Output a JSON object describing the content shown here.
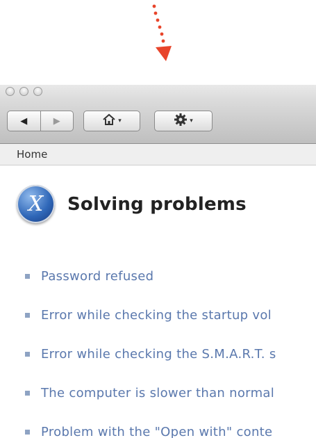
{
  "window": {
    "toolbar": {
      "back_label": "◀",
      "forward_label": "▶",
      "home_icon": "home-icon",
      "settings_icon": "gear-icon",
      "caret": "▾"
    },
    "breadcrumb": "Home"
  },
  "main": {
    "title": "Solving problems",
    "logo_letter": "X",
    "problems": [
      "Password refused",
      "Error while checking the startup vol",
      "Error while checking the S.M.A.R.T. s",
      "The computer is slower than normal",
      "Problem with the \"Open with\" conte"
    ]
  },
  "colors": {
    "arrow": "#e8452b",
    "link": "#5a78ad",
    "bullet": "#8ea3c3"
  }
}
